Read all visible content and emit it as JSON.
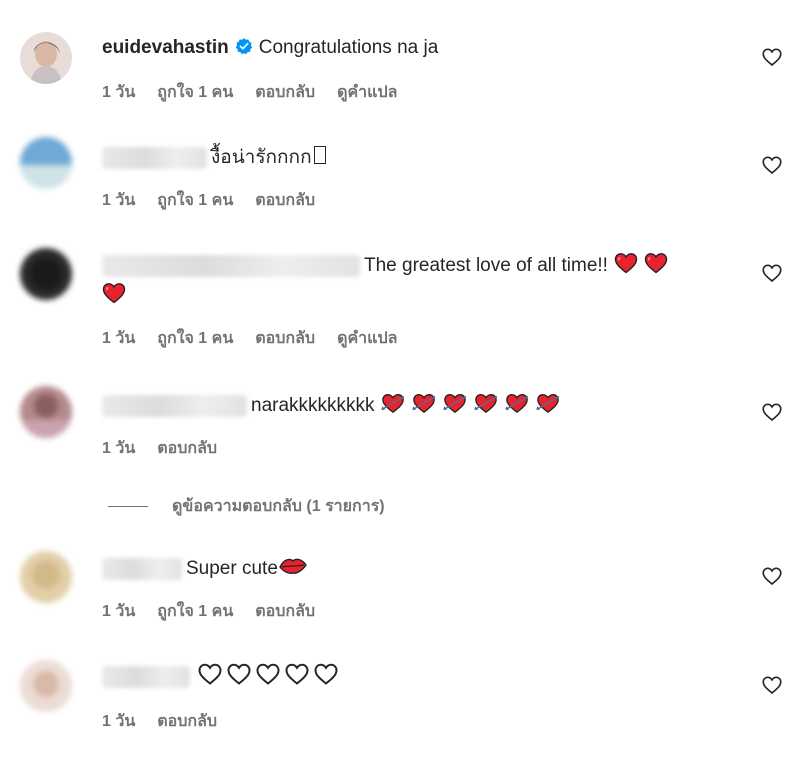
{
  "colors": {
    "text": "#262626",
    "meta": "#737373",
    "verified": "#0095f6",
    "heart_red": "#e8232f"
  },
  "icons": {
    "like": "heart-outline-icon",
    "verified": "verified-badge-icon"
  },
  "comments": [
    {
      "username": "euidevahastin",
      "verified": true,
      "text": "Congratulations na ja",
      "time": "1 วัน",
      "likes": "ถูกใจ 1 คน",
      "reply": "ตอบกลับ",
      "translate": "ดูคำแปล"
    },
    {
      "text": "งื้อน่ารักกกก",
      "time": "1 วัน",
      "likes": "ถูกใจ 1 คน",
      "reply": "ตอบกลับ"
    },
    {
      "text": "The greatest love of all time!!",
      "time": "1 วัน",
      "likes": "ถูกใจ 1 คน",
      "reply": "ตอบกลับ",
      "translate": "ดูคำแปล"
    },
    {
      "text": "narakkkkkkkkk",
      "time": "1 วัน",
      "reply": "ตอบกลับ"
    },
    {
      "text": "Super cute",
      "time": "1 วัน",
      "likes": "ถูกใจ 1 คน",
      "reply": "ตอบกลับ"
    },
    {
      "text": "",
      "time": "1 วัน",
      "reply": "ตอบกลับ"
    }
  ],
  "view_replies": "ดูข้อความตอบกลับ (1 รายการ)"
}
